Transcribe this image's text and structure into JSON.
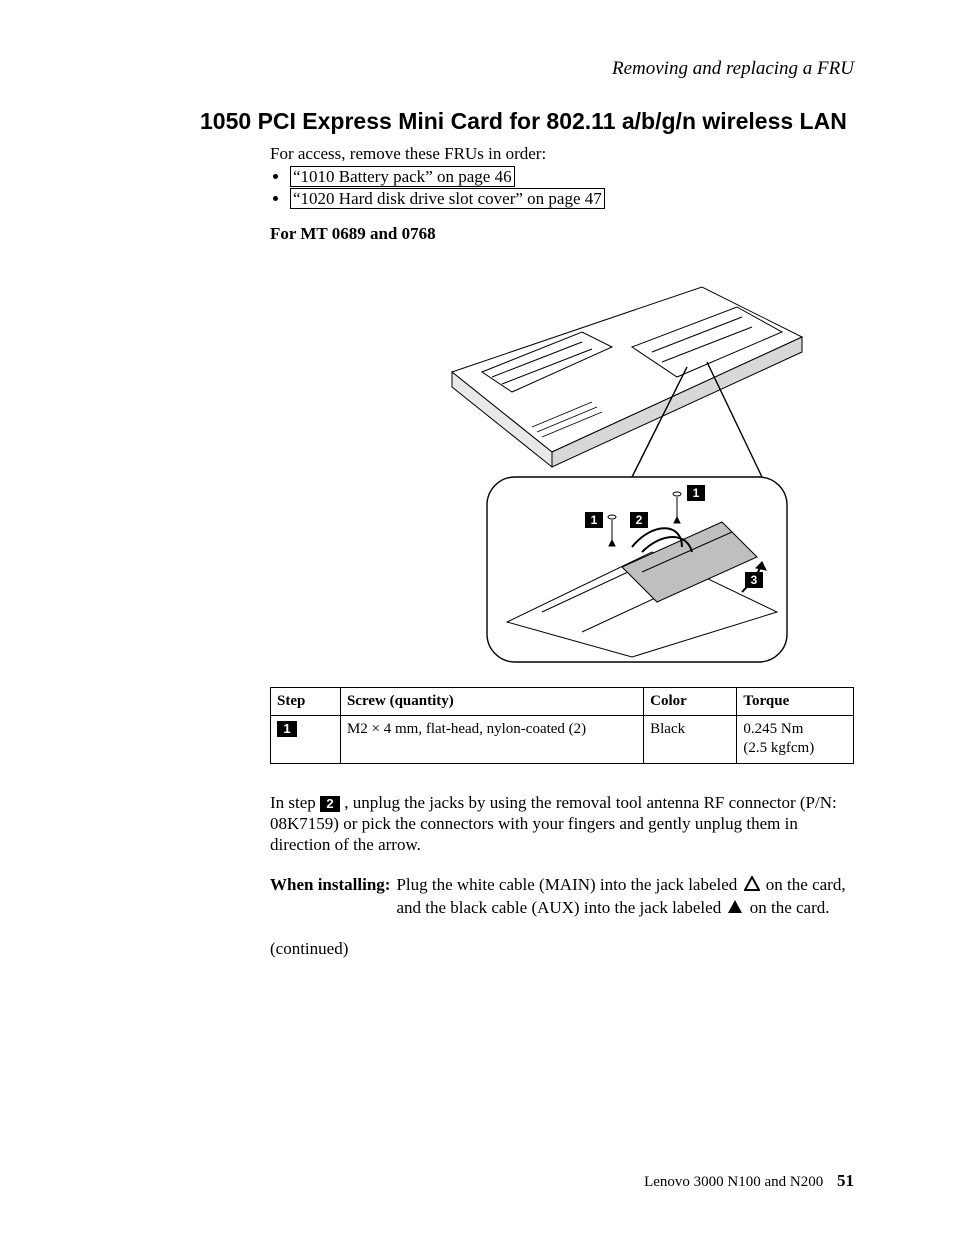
{
  "header": {
    "running_title": "Removing and replacing a FRU"
  },
  "section": {
    "number": "1050",
    "title": "PCI Express Mini Card for 802.11 a/b/g/n wireless LAN",
    "intro": "For access, remove these FRUs in order:",
    "frus": [
      {
        "quote_open": "“",
        "text": "1010 Battery pack",
        "quote_close": "”",
        "page_ref": " on page 46"
      },
      {
        "quote_open": "“",
        "text": "1020 Hard disk drive slot cover",
        "quote_close": "”",
        "page_ref": " on page 47"
      }
    ],
    "subhead": "For MT 0689 and 0768"
  },
  "figure": {
    "callouts": {
      "a": "1",
      "b": "1",
      "c": "2",
      "d": "3"
    }
  },
  "table": {
    "headers": {
      "step": "Step",
      "screw": "Screw (quantity)",
      "color": "Color",
      "torque": "Torque"
    },
    "row": {
      "step": "1",
      "screw": "M2 × 4 mm, flat-head, nylon-coated (2)",
      "color": "Black",
      "torque_line1": "0.245 Nm",
      "torque_line2": "(2.5 kgfcm)"
    }
  },
  "paragraphs": {
    "step2_prefix": "In step ",
    "step2_callout": "2",
    "step2_text": ", unplug the jacks by using the removal tool antenna RF connector (P/N: 08K7159) or pick the connectors with your fingers and gently unplug them in direction of the arrow.",
    "install_label": "When installing:",
    "install_text_a": "Plug the white cable (MAIN) into the jack labeled ",
    "install_text_b": " on the card, and the black cable (AUX) into the jack labeled ",
    "install_text_c": " on the card.",
    "continued": "(continued)"
  },
  "footer": {
    "book": "Lenovo 3000 N100 and N200",
    "page": "51"
  }
}
